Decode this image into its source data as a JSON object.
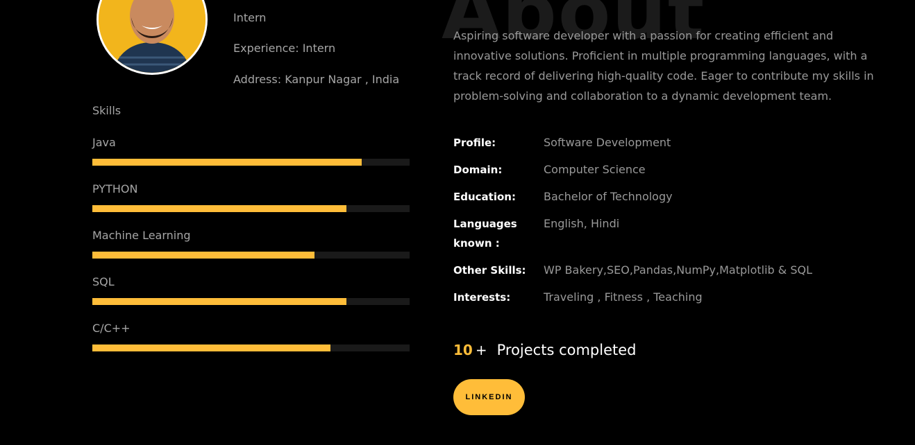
{
  "profile_info": {
    "role": "Intern",
    "experience": "Experience: Intern",
    "address": "Address: Kanpur Nagar , India"
  },
  "skills": {
    "heading": "Skills",
    "items": [
      {
        "label": "Java",
        "percent": 85
      },
      {
        "label": "PYTHON",
        "percent": 80
      },
      {
        "label": "Machine Learning",
        "percent": 70
      },
      {
        "label": "SQL",
        "percent": 80
      },
      {
        "label": "C/C++",
        "percent": 75
      }
    ]
  },
  "about": {
    "watermark": "About",
    "text": "Aspiring software developer with a passion for creating efficient and innovative solutions. Proficient in multiple programming languages, with a track record of delivering high-quality code. Eager to contribute my skills in problem-solving and collaboration to a dynamic development team."
  },
  "details": [
    {
      "key": "Profile:",
      "value": "Software Development"
    },
    {
      "key": "Domain:",
      "value": "Computer Science"
    },
    {
      "key": "Education:",
      "value": "Bachelor of Technology"
    },
    {
      "key": "Languages known :",
      "value": "English, Hindi"
    },
    {
      "key": "Other Skills:",
      "value": "WP Bakery,SEO,Pandas,NumPy,Matplotlib & SQL"
    },
    {
      "key": "Interests:",
      "value": "Traveling , Fitness , Teaching"
    }
  ],
  "counter": {
    "number": "10",
    "plus": "+",
    "label": "Projects completed"
  },
  "linkedin_button": "LINKEDIN",
  "colors": {
    "background": "#000000",
    "accent": "#ffbd39",
    "track": "#1a1a1a",
    "muted_text": "#a6a6a6",
    "heading_text": "#ffffff"
  }
}
